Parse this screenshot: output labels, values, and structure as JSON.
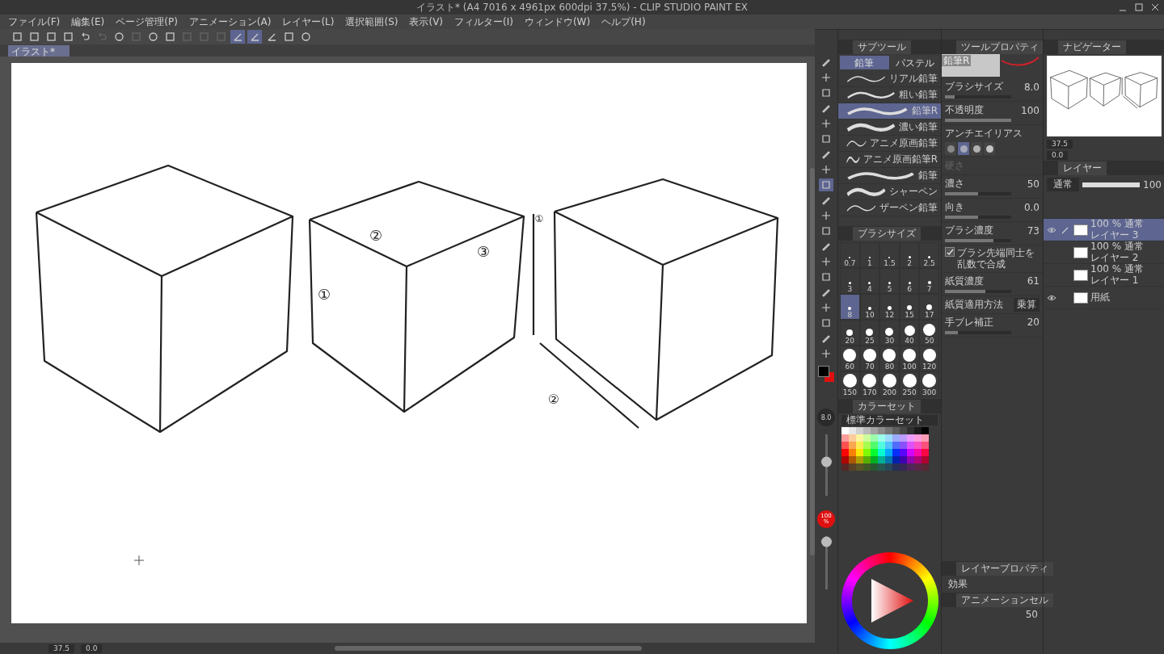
{
  "window": {
    "title": "イラスト* (A4 7016 x 4961px 600dpi 37.5%) - CLIP STUDIO PAINT EX"
  },
  "menu": [
    "ファイル(F)",
    "編集(E)",
    "ページ管理(P)",
    "アニメーション(A)",
    "レイヤー(L)",
    "選択範囲(S)",
    "表示(V)",
    "フィルター(I)",
    "ウィンドウ(W)",
    "ヘルプ(H)"
  ],
  "toolbar": [
    {
      "selected": false,
      "disabled": false
    },
    {
      "selected": false,
      "disabled": false
    },
    {
      "selected": false,
      "disabled": false
    },
    {
      "selected": false,
      "disabled": false
    },
    {
      "selected": false,
      "disabled": false
    },
    {
      "selected": false,
      "disabled": true
    },
    {
      "selected": false,
      "disabled": false
    },
    {
      "selected": false,
      "disabled": true
    },
    {
      "selected": false,
      "disabled": false
    },
    {
      "selected": false,
      "disabled": false
    },
    {
      "selected": false,
      "disabled": true
    },
    {
      "selected": false,
      "disabled": true
    },
    {
      "selected": false,
      "disabled": true
    },
    {
      "selected": true,
      "disabled": false
    },
    {
      "selected": true,
      "disabled": false
    },
    {
      "selected": false,
      "disabled": false
    },
    {
      "selected": false,
      "disabled": false
    },
    {
      "selected": false,
      "disabled": false
    }
  ],
  "document_tab": "イラスト*",
  "canvas": {
    "annotations": [
      "①",
      "②",
      "③",
      "①",
      "②"
    ]
  },
  "status_bar": {
    "zoom": "37.5",
    "rotation": "0.0"
  },
  "tools": [
    {
      "selected": false
    },
    {
      "selected": false
    },
    {
      "selected": false
    },
    {
      "selected": false
    },
    {
      "selected": false
    },
    {
      "selected": false
    },
    {
      "selected": false
    },
    {
      "selected": false
    },
    {
      "selected": true
    },
    {
      "selected": false
    },
    {
      "selected": false
    },
    {
      "selected": false
    },
    {
      "selected": false
    },
    {
      "selected": false
    },
    {
      "selected": false
    },
    {
      "selected": false
    },
    {
      "selected": false
    },
    {
      "selected": false
    },
    {
      "selected": false
    },
    {
      "selected": false
    }
  ],
  "side_indicators": {
    "brush_size": "8.0",
    "size_slider": {
      "level": 0.55
    },
    "opacity": "100 %",
    "opacity_slider": {
      "level": 0.9
    }
  },
  "sub_tool": {
    "title": "サブツール",
    "tabs": [
      {
        "label": "鉛筆",
        "selected": true
      },
      {
        "label": "パステル",
        "selected": false
      }
    ],
    "brushes": [
      {
        "name": "リアル鉛筆",
        "selected": false
      },
      {
        "name": "粗い鉛筆",
        "selected": false
      },
      {
        "name": "鉛筆R",
        "selected": true
      },
      {
        "name": "濃い鉛筆",
        "selected": false
      },
      {
        "name": "アニメ原画鉛筆",
        "selected": false
      },
      {
        "name": "アニメ原画鉛筆R",
        "selected": false
      },
      {
        "name": "鉛筆",
        "selected": false
      },
      {
        "name": "シャーペン",
        "selected": false
      },
      {
        "name": "ザーペン鉛筆",
        "selected": false
      }
    ]
  },
  "brush_size": {
    "title": "ブラシサイズ",
    "sizes": [
      {
        "label": "0.7",
        "selected": false
      },
      {
        "label": "1",
        "selected": false
      },
      {
        "label": "1.5",
        "selected": false
      },
      {
        "label": "2",
        "selected": false
      },
      {
        "label": "2.5",
        "selected": false
      },
      {
        "label": "3",
        "selected": false
      },
      {
        "label": "4",
        "selected": false
      },
      {
        "label": "5",
        "selected": false
      },
      {
        "label": "6",
        "selected": false
      },
      {
        "label": "7",
        "selected": false
      },
      {
        "label": "8",
        "selected": true
      },
      {
        "label": "10",
        "selected": false
      },
      {
        "label": "12",
        "selected": false
      },
      {
        "label": "15",
        "selected": false
      },
      {
        "label": "17",
        "selected": false
      },
      {
        "label": "20",
        "selected": false
      },
      {
        "label": "25",
        "selected": false
      },
      {
        "label": "30",
        "selected": false
      },
      {
        "label": "40",
        "selected": false
      },
      {
        "label": "50",
        "selected": false
      },
      {
        "label": "60",
        "selected": false
      },
      {
        "label": "70",
        "selected": false
      },
      {
        "label": "80",
        "selected": false
      },
      {
        "label": "100",
        "selected": false
      },
      {
        "label": "120",
        "selected": false
      },
      {
        "label": "150",
        "selected": false
      },
      {
        "label": "170",
        "selected": false
      },
      {
        "label": "200",
        "selected": false
      },
      {
        "label": "250",
        "selected": false
      },
      {
        "label": "300",
        "selected": false
      }
    ]
  },
  "color_set": {
    "title": "カラーセット",
    "set_name": "標準カラーセット"
  },
  "tool_property": {
    "title": "ツールプロパティ",
    "preview_label": "鉛筆R",
    "rows": [
      {
        "kind": "slider",
        "label": "ブラシサイズ",
        "value": "8.0",
        "level": 0.15,
        "disabled": false
      },
      {
        "kind": "slider",
        "label": "不透明度",
        "value": "100",
        "level": 1,
        "disabled": false
      },
      {
        "kind": "antialias",
        "label": "アンチエイリアス",
        "options": [
          {
            "selected": false
          },
          {
            "selected": true
          },
          {
            "selected": false
          },
          {
            "selected": false
          }
        ]
      },
      {
        "kind": "slider",
        "label": "硬さ",
        "disabled": true
      },
      {
        "kind": "slider",
        "label": "濃さ",
        "value": "50",
        "level": 0.5,
        "disabled": false
      },
      {
        "kind": "slider",
        "label": "向き",
        "value": "0.0",
        "level": 0.5,
        "disabled": false
      },
      {
        "kind": "slider",
        "label": "ブラシ濃度",
        "value": "73",
        "level": 0.73,
        "disabled": false
      },
      {
        "kind": "checkbox",
        "label": "ブラシ先端同士を乱数で合成",
        "checked": true
      },
      {
        "kind": "slider",
        "label": "紙質濃度",
        "value": "61",
        "level": 0.61,
        "disabled": false
      },
      {
        "kind": "dropdown",
        "label": "紙質適用方法",
        "value": "乗算"
      },
      {
        "kind": "slider",
        "label": "手ブレ補正",
        "value": "20",
        "level": 0.2,
        "disabled": false
      }
    ]
  },
  "layer_property": {
    "title": "レイヤープロパティ",
    "label": "効果"
  },
  "animation_cel": {
    "title": "アニメーションセル",
    "value": "50"
  },
  "navigator": {
    "title": "ナビゲーター",
    "zoom": "37.5",
    "rotation": "0.0"
  },
  "layers": {
    "title": "レイヤー",
    "blend": "通常",
    "opacity": {
      "value": "100",
      "level": 1
    },
    "items": [
      {
        "mode": "100 % 通常",
        "name": "レイヤー 3",
        "selected": true,
        "visible": true
      },
      {
        "mode": "100 % 通常",
        "name": "レイヤー 2",
        "selected": false,
        "visible": false
      },
      {
        "mode": "100 % 通常",
        "name": "レイヤー 1",
        "selected": false,
        "visible": false
      },
      {
        "name": "用紙",
        "selected": false,
        "visible": true
      }
    ]
  }
}
